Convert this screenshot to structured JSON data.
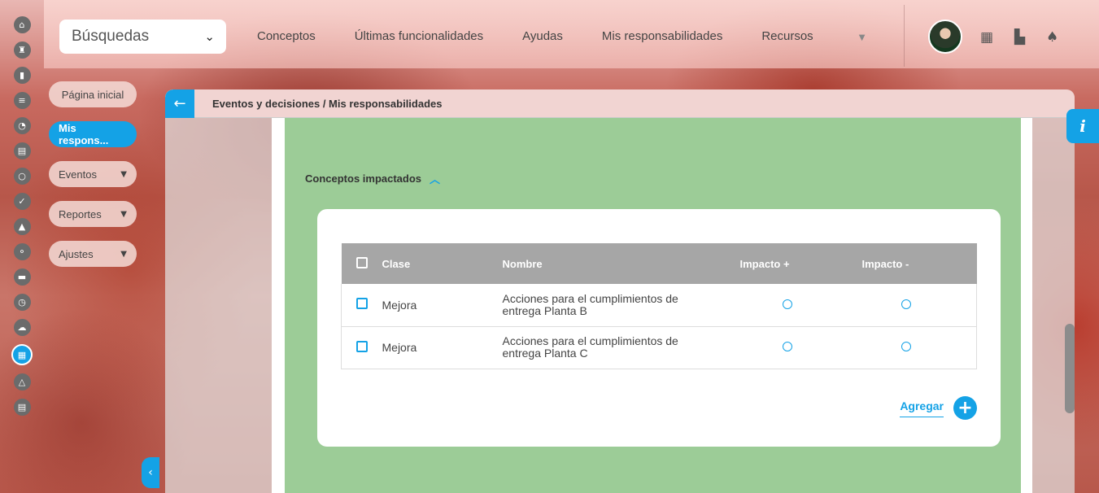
{
  "search": {
    "label": "Búsquedas"
  },
  "topnav": {
    "items": [
      "Conceptos",
      "Últimas funcionalidades",
      "Ayudas",
      "Mis responsabilidades",
      "Recursos"
    ]
  },
  "leftmenu": {
    "items": [
      {
        "label": "Página inicial",
        "has_caret": false,
        "active": false
      },
      {
        "label": "Mis respons...",
        "has_caret": false,
        "active": true
      },
      {
        "label": "Eventos",
        "has_caret": true,
        "active": false
      },
      {
        "label": "Reportes",
        "has_caret": true,
        "active": false
      },
      {
        "label": "Ajustes",
        "has_caret": true,
        "active": false
      }
    ]
  },
  "panel": {
    "breadcrumb": "Eventos y decisiones / Mis responsabilidades"
  },
  "section": {
    "title": "Conceptos impactados"
  },
  "table": {
    "headers": {
      "clase": "Clase",
      "nombre": "Nombre",
      "impacto_pos": "Impacto +",
      "impacto_neg": "Impacto -"
    },
    "rows": [
      {
        "clase": "Mejora",
        "nombre_line1": "Acciones para el cumplimientos de",
        "nombre_line2": "entrega Planta B"
      },
      {
        "clase": "Mejora",
        "nombre_line1": "Acciones para el cumplimientos de",
        "nombre_line2": "entrega Planta C"
      }
    ]
  },
  "add": {
    "label": "Agregar",
    "icon": "plus-icon"
  },
  "info": {
    "label": "i"
  },
  "colors": {
    "accent": "#14a2e6",
    "green_area": "#9ccc97",
    "header_gray": "#a6a6a6"
  }
}
